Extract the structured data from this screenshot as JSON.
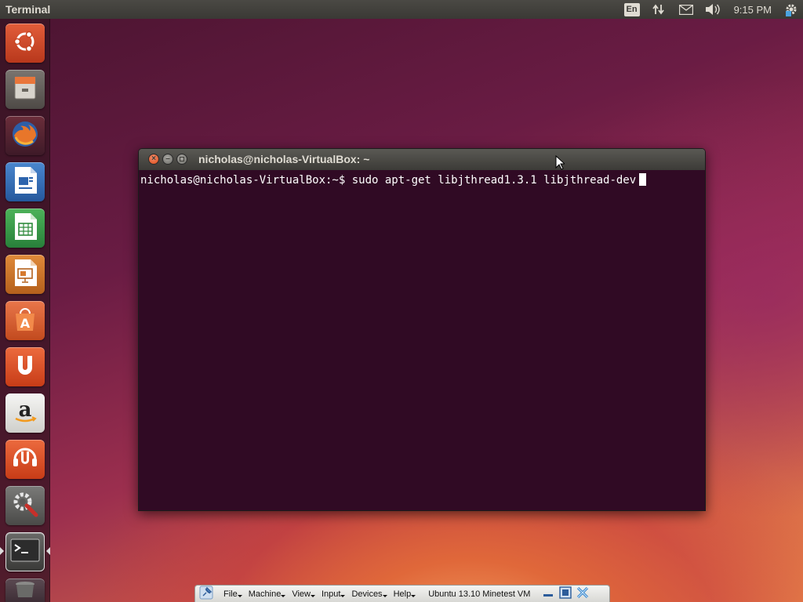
{
  "panel": {
    "app_title": "Terminal",
    "lang_indicator": "En",
    "clock": "9:15 PM",
    "indicator_icons": [
      "network-icon",
      "mail-icon",
      "volume-icon",
      "system-gear-icon"
    ]
  },
  "launcher": {
    "items": [
      {
        "name": "ubuntu-dash",
        "icon": "ubuntu-logo-icon",
        "color": "#d24a2a"
      },
      {
        "name": "files",
        "icon": "file-cabinet-icon",
        "color": "#b8b4ac"
      },
      {
        "name": "firefox",
        "icon": "firefox-icon",
        "color": "#e5762a"
      },
      {
        "name": "libreoffice-writer",
        "icon": "writer-document-icon",
        "color": "#3d7cc9"
      },
      {
        "name": "libreoffice-calc",
        "icon": "calc-spreadsheet-icon",
        "color": "#3aa14a"
      },
      {
        "name": "libreoffice-impress",
        "icon": "impress-presentation-icon",
        "color": "#d67a2e"
      },
      {
        "name": "ubuntu-software-center",
        "icon": "shopping-bag-icon",
        "color": "#e0672c"
      },
      {
        "name": "ubuntu-one",
        "icon": "ubuntu-one-icon",
        "color": "#e3532a"
      },
      {
        "name": "amazon",
        "icon": "amazon-icon",
        "color": "#e9e9e9"
      },
      {
        "name": "ubuntu-one-music",
        "icon": "ubuntu-one-music-icon",
        "color": "#e3532a"
      },
      {
        "name": "system-settings",
        "icon": "settings-wrench-icon",
        "color": "#8a8a8a"
      },
      {
        "name": "terminal",
        "icon": "terminal-icon",
        "color": "#4a4a4a"
      },
      {
        "name": "trash",
        "icon": "trash-icon",
        "color": "#6a5a60"
      }
    ]
  },
  "terminal": {
    "title": "nicholas@nicholas-VirtualBox: ~",
    "prompt_line": "nicholas@nicholas-VirtualBox:~$ sudo apt-get libjthread1.3.1 libjthread-dev"
  },
  "vbox_toolbar": {
    "menus": [
      "File",
      "Machine",
      "View",
      "Input",
      "Devices",
      "Help"
    ],
    "vm_name": "Ubuntu 13.10 Minetest VM"
  }
}
